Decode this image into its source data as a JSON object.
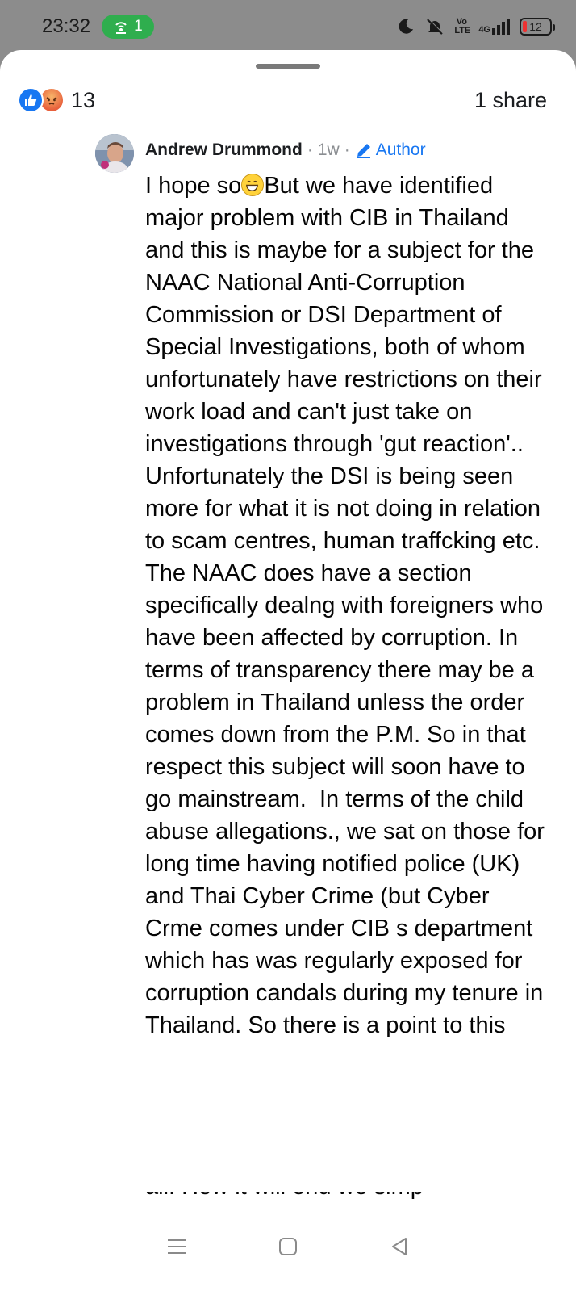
{
  "status_bar": {
    "time": "23:32",
    "hotspot_count": "1",
    "volte": "Vo LTE",
    "network": "4G",
    "battery": "12",
    "icons": [
      "do-not-disturb-moon-icon",
      "vibrate-off-icon",
      "volte-icon",
      "signal-4g-icon",
      "battery-icon"
    ]
  },
  "reactions": {
    "icons": [
      "like-icon",
      "angry-icon"
    ],
    "count": "13",
    "shares": "1 share"
  },
  "comment": {
    "author": "Andrew Drummond",
    "time_ago": "1w",
    "separator": "·",
    "badge": "Author",
    "text_lead": "I hope so",
    "text_main": "But we have identified major problem with CIB in Thailand and this is maybe for a subject for the NAAC National Anti-Corruption Commission or DSI Department of Special Investigations, both of whom unfortunately have restrictions on their work load and can't just take on investigations through 'gut reaction'.. Unfortunately the DSI is being seen more for what it is not doing in relation to scam centres, human traffcking etc. The NAAC does have a section specifically dealng with foreigners who have been affected by corruption. In terms of transparency there may be a problem in Thailand unless the order comes down from the P.M. So in that respect this subject will soon have to go mainstream.  In terms of the child abuse allegations., we sat on those for long time having notified police (UK) and Thai Cyber Crime (but Cyber Crme comes under CIB s department which has was regularly exposed for corruption candals during my tenure in Thailand. So there is a point to this",
    "text_cut": "all. How it will end we simp"
  },
  "colors": {
    "brand_blue": "#1877f2",
    "hotspot_green": "#2fae4e",
    "status_bg": "#8c8c8c"
  },
  "nav": {
    "icons": [
      "recent-apps-icon",
      "home-icon",
      "back-icon"
    ]
  }
}
